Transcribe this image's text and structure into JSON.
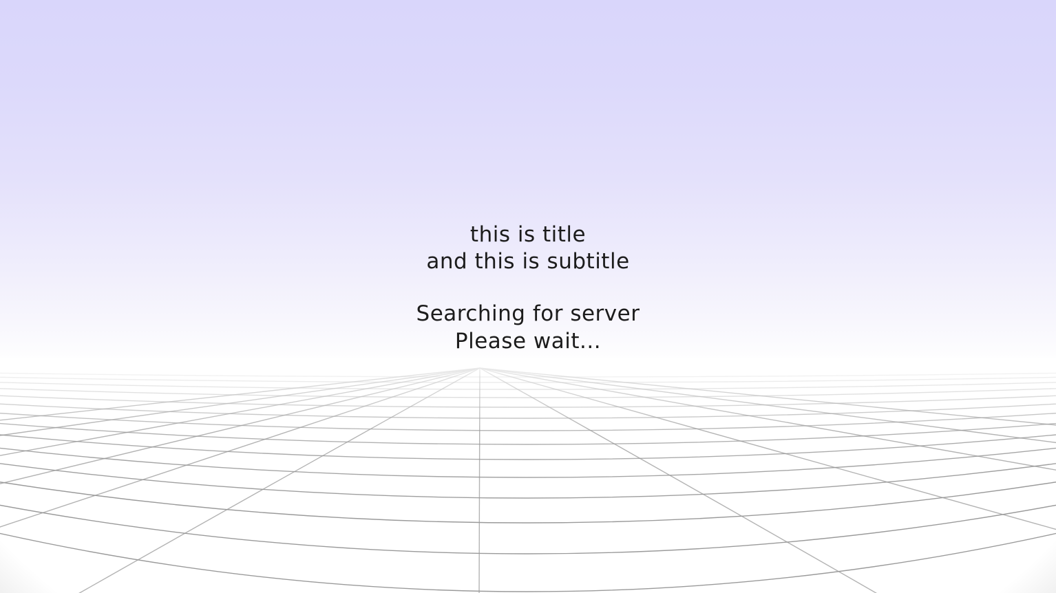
{
  "scene": {
    "background_top_color": "#d9d6fb",
    "horizon_color": "#ffffff",
    "grid_line_color": "#9a9a9a"
  },
  "loading_message": {
    "title": "this is title",
    "subtitle": "and this is subtitle",
    "status": "Searching for server",
    "wait": "Please wait..."
  }
}
